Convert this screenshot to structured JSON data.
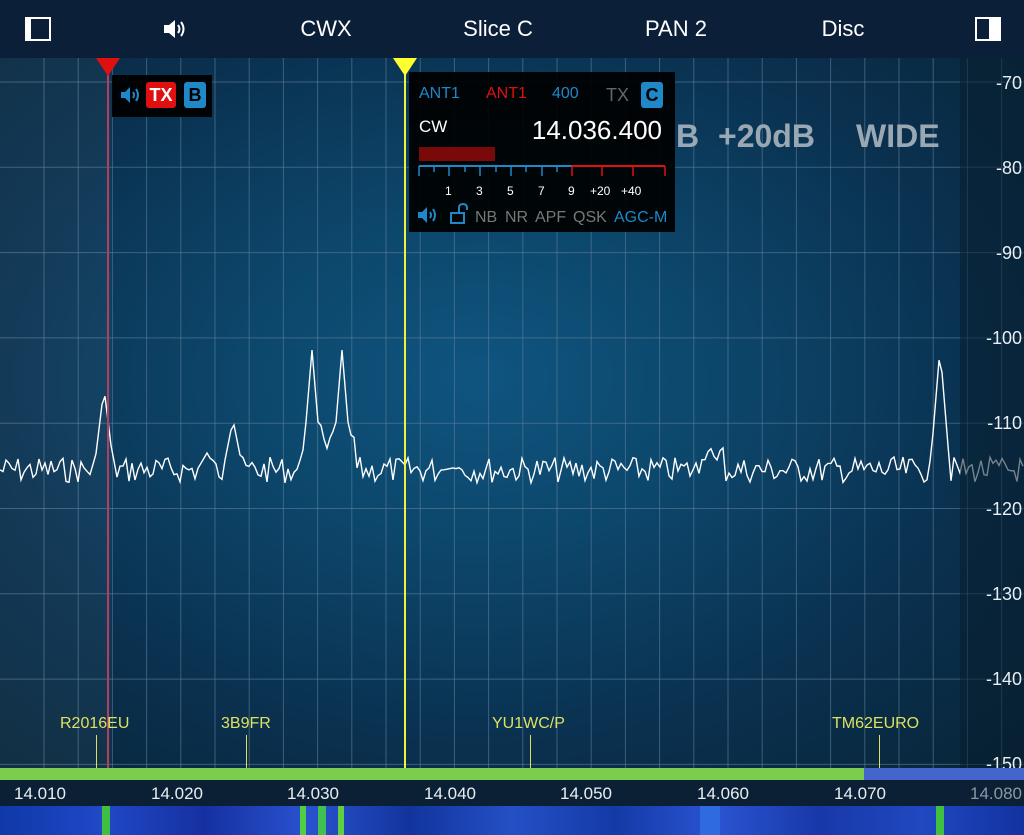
{
  "toolbar": {
    "left_icon": "panel-left-icon",
    "volume_icon": "speaker-icon",
    "mode": "CWX",
    "slice": "Slice C",
    "pan": "PAN 2",
    "disc": "Disc",
    "right_icon": "panel-right-icon"
  },
  "scale": {
    "db_labels": [
      "-70",
      "-80",
      "-90",
      "-100",
      "-110",
      "-120",
      "-130",
      "-140",
      "-150"
    ]
  },
  "frequency_axis": {
    "labels": [
      "14.010",
      "14.020",
      "14.030",
      "14.040",
      "14.050",
      "14.060",
      "14.070",
      "14.080"
    ]
  },
  "spots": [
    "R2016EU",
    "3B9FR",
    "YU1WC/P",
    "TM62EURO"
  ],
  "overlay_text": {
    "b": "B",
    "gain": "+20dB",
    "width": "WIDE"
  },
  "slice_b": {
    "speaker_icon": "speaker-icon",
    "tx": "TX",
    "letter": "B"
  },
  "slice_c": {
    "rx_ant": "ANT1",
    "tx_ant": "ANT1",
    "filter": "400",
    "tx": "TX",
    "letter": "C",
    "mode": "CW",
    "frequency": "14.036.400",
    "meter_labels": [
      "1",
      "3",
      "5",
      "7",
      "9",
      "+20",
      "+40"
    ],
    "buttons": [
      "NB",
      "NR",
      "APF",
      "QSK",
      "AGC-M"
    ],
    "speaker_icon": "speaker-icon",
    "lock_icon": "unlock-icon"
  },
  "colors": {
    "accent_blue": "#1e88c8",
    "tx_red": "#e01010",
    "marker_yellow": "#ffff30",
    "marker_red": "#e01010",
    "spot_yellow": "#e0e060",
    "band_green": "#7ccc50",
    "band_blue": "#4466cc"
  }
}
